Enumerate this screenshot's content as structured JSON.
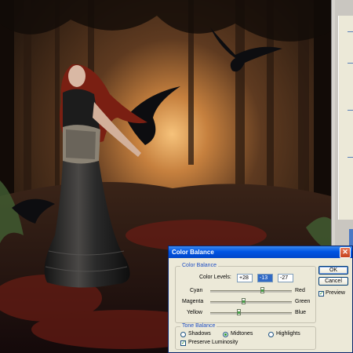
{
  "dialog": {
    "title": "Color Balance",
    "close_glyph": "✕",
    "color_balance": {
      "group_label": "Color Balance",
      "levels_label": "Color Levels:",
      "levels": [
        "+28",
        "-13",
        "-27"
      ],
      "sliders": [
        {
          "left": "Cyan",
          "right": "Red",
          "value": 28
        },
        {
          "left": "Magenta",
          "right": "Green",
          "value": -13
        },
        {
          "left": "Yellow",
          "right": "Blue",
          "value": -27
        }
      ]
    },
    "tone_balance": {
      "group_label": "Tone Balance",
      "options": [
        "Shadows",
        "Midtones",
        "Highlights"
      ],
      "selected": "Midtones",
      "preserve_label": "Preserve Luminosity",
      "preserve_checked": true
    },
    "buttons": {
      "ok": "OK",
      "cancel": "Cancel"
    },
    "preview_label": "Preview",
    "preview_checked": true
  },
  "colors": {
    "titlebar": "#0054e3",
    "dialog_bg": "#ece9d8",
    "selected_field": "#316ac5",
    "group_label": "#2150c4"
  },
  "icons": [
    "close-icon",
    "radio-icon",
    "checkbox-icon",
    "slider-thumb-icon"
  ]
}
